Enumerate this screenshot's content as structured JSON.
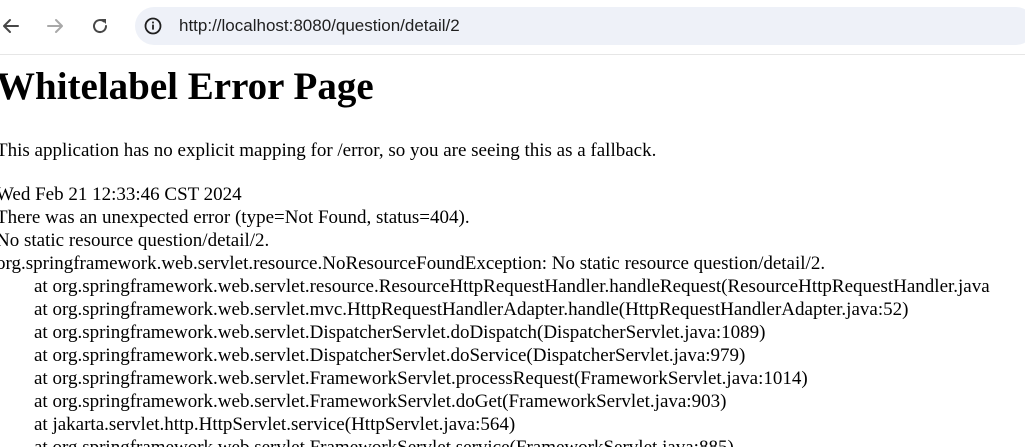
{
  "browser": {
    "url": "http://localhost:8080/question/detail/2",
    "icons": {
      "back": "arrow-left-icon",
      "forward": "arrow-right-icon",
      "reload": "reload-icon",
      "site_info": "info-icon"
    }
  },
  "page": {
    "title": "Whitelabel Error Page",
    "fallback_message": "This application has no explicit mapping for /error, so you are seeing this as a fallback.",
    "timestamp": "Wed Feb 21 12:33:46 CST 2024",
    "error_summary": "There was an unexpected error (type=Not Found, status=404).",
    "error_message": "No static resource question/detail/2.",
    "exception": "org.springframework.web.servlet.resource.NoResourceFoundException: No static resource question/detail/2.",
    "stack_trace": [
      "at org.springframework.web.servlet.resource.ResourceHttpRequestHandler.handleRequest(ResourceHttpRequestHandler.java",
      "at org.springframework.web.servlet.mvc.HttpRequestHandlerAdapter.handle(HttpRequestHandlerAdapter.java:52)",
      "at org.springframework.web.servlet.DispatcherServlet.doDispatch(DispatcherServlet.java:1089)",
      "at org.springframework.web.servlet.DispatcherServlet.doService(DispatcherServlet.java:979)",
      "at org.springframework.web.servlet.FrameworkServlet.processRequest(FrameworkServlet.java:1014)",
      "at org.springframework.web.servlet.FrameworkServlet.doGet(FrameworkServlet.java:903)",
      "at jakarta.servlet.http.HttpServlet.service(HttpServlet.java:564)",
      "at org.springframework.web.servlet.FrameworkServlet.service(FrameworkServlet.java:885)"
    ]
  }
}
